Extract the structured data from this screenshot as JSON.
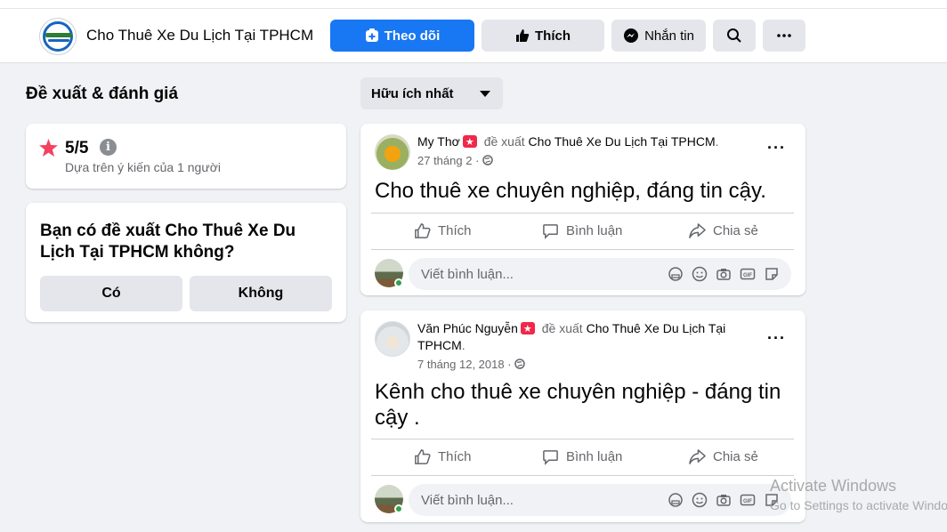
{
  "header": {
    "page_name": "Cho Thuê Xe Du Lịch Tại TPHCM",
    "follow_label": "Theo dõi",
    "like_label": "Thích",
    "message_label": "Nhắn tin",
    "accent_color": "#1877f2"
  },
  "left": {
    "section_title": "Đề xuất & đánh giá",
    "rating": {
      "score": "5/5",
      "basis": "Dựa trên ý kiến của 1 người"
    },
    "question": "Bạn có đề xuất Cho Thuê Xe Du Lịch Tại TPHCM không?",
    "yes_label": "Có",
    "no_label": "Không"
  },
  "sort": {
    "selected": "Hữu ích nhất"
  },
  "posts": [
    {
      "author": "My Thơ",
      "recommends": "đề xuất",
      "page": "Cho Thuê Xe Du Lịch Tại TPHCM",
      "date": "27 tháng 2",
      "text": "Cho thuê xe chuyên nghiệp, đáng tin cậy."
    },
    {
      "author": "Văn Phúc Nguyễn",
      "recommends": "đề xuất",
      "page": "Cho Thuê Xe Du Lịch Tại TPHCM",
      "date": "7 tháng 12, 2018",
      "text": "Kênh cho thuê xe chuyên nghiệp - đáng tin cậy ."
    }
  ],
  "actions": {
    "like": "Thích",
    "comment": "Bình luận",
    "share": "Chia sẻ",
    "comment_placeholder": "Viết bình luận..."
  },
  "watermark": {
    "title": "Activate Windows",
    "subtitle": "Go to Settings to activate Windows."
  },
  "icons": [
    "page-logo",
    "follow-plus-icon",
    "thumbs-up-icon",
    "messenger-icon",
    "search-icon",
    "more-icon",
    "star-icon",
    "info-icon",
    "caret-down-icon",
    "globe-icon",
    "comment-icon",
    "share-icon",
    "sticker-icon",
    "emoji-icon",
    "camera-icon",
    "gif-icon"
  ]
}
